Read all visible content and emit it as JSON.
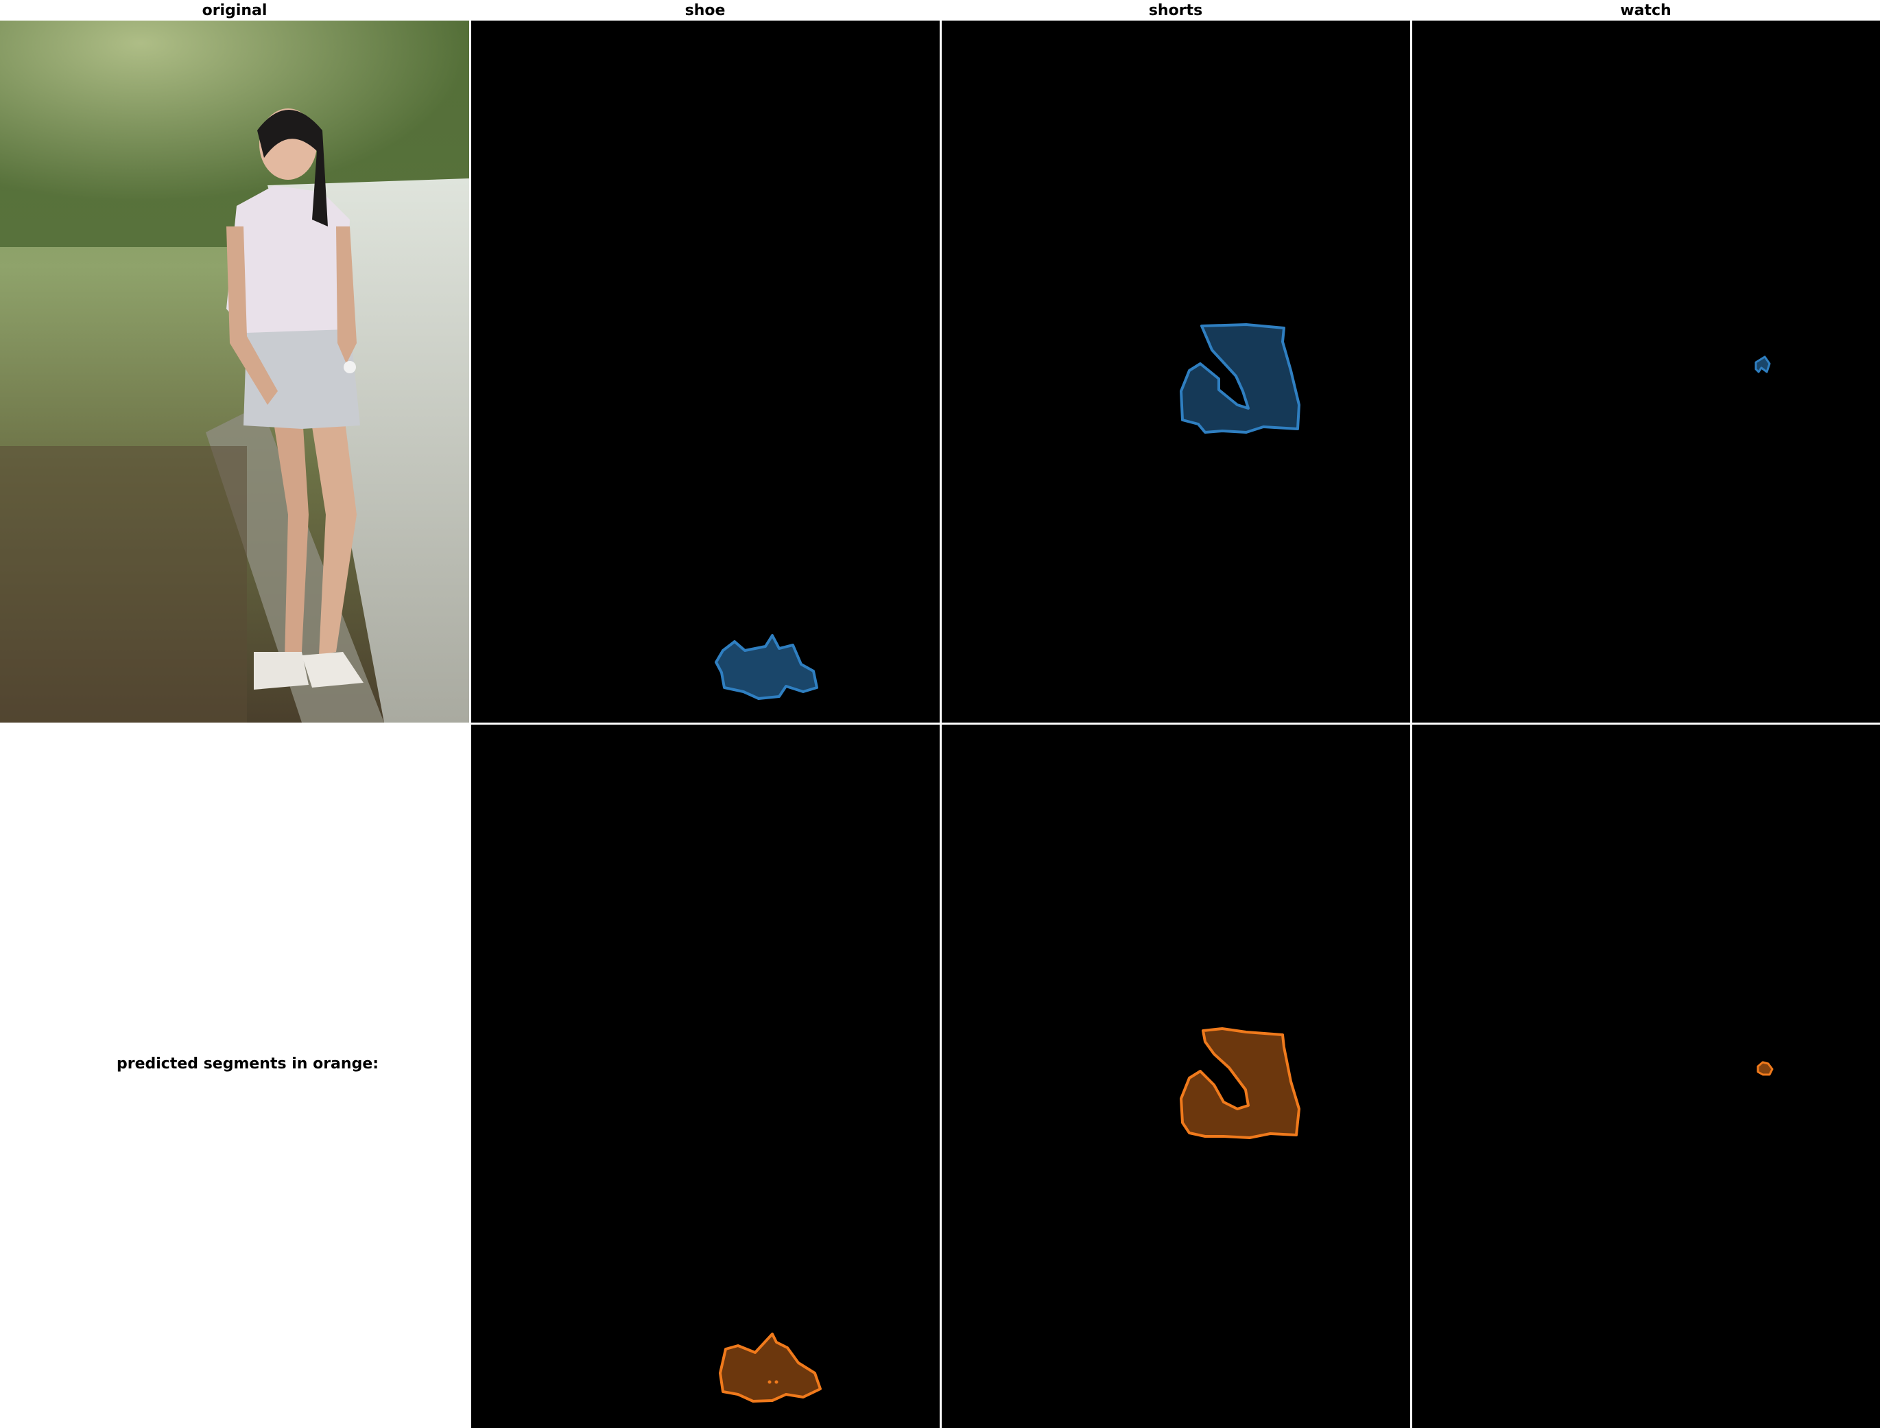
{
  "columns": [
    {
      "key": "original",
      "label": "original"
    },
    {
      "key": "shoe",
      "label": "shoe"
    },
    {
      "key": "shorts",
      "label": "shorts"
    },
    {
      "key": "watch",
      "label": "watch"
    }
  ],
  "note": "predicted segments in orange:",
  "colors": {
    "ground_truth": "#2f7fc1",
    "prediction": "#f07a1c",
    "panel_background": "#000000"
  },
  "photo": {
    "subject": "woman in white shirt and grey shorts standing on a path"
  }
}
